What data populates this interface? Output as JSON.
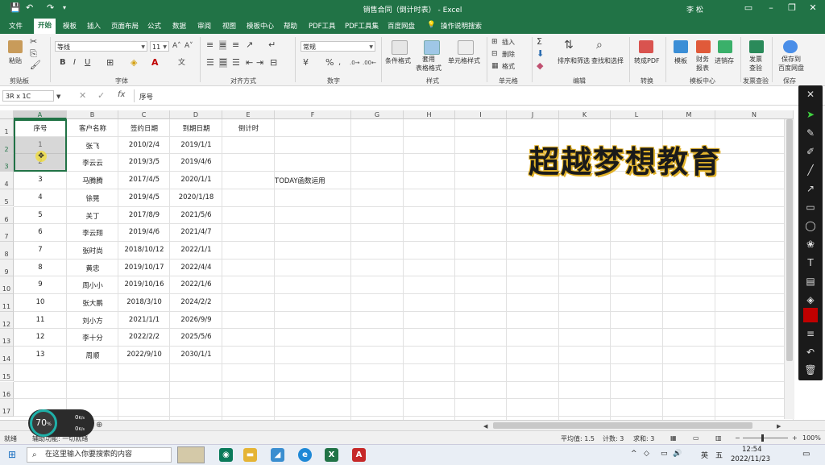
{
  "window": {
    "title": "销售合同（倒计时表） - Excel",
    "user": "李 松"
  },
  "menu": [
    "文件",
    "开始",
    "模板",
    "插入",
    "页面布局",
    "公式",
    "数据",
    "审阅",
    "视图",
    "模板中心",
    "帮助",
    "PDF工具",
    "PDF工具集",
    "百度网盘",
    "操作说明搜索"
  ],
  "active_tab": "开始",
  "ribbon": {
    "clipboard": {
      "paste": "粘贴",
      "label": "剪贴板"
    },
    "font": {
      "name": "等线",
      "size": "11",
      "label": "字体",
      "bold": "B",
      "italic": "I",
      "underline": "U"
    },
    "alignment": {
      "label": "对齐方式"
    },
    "number": {
      "format": "常规",
      "label": "数字"
    },
    "styles": {
      "cond": "条件格式",
      "table": "套用\n表格格式",
      "cell": "单元格样式",
      "label": "样式"
    },
    "cells": {
      "insert": "插入",
      "delete": "删除",
      "format": "格式",
      "label": "单元格"
    },
    "editing": {
      "sort": "排序和筛选",
      "find": "查找和选择",
      "label": "编辑"
    },
    "convert": {
      "pdf": "转成PDF",
      "label": "转换"
    },
    "template": {
      "tmpl": "模板",
      "fin": "财务\n报表",
      "sales": "进销存",
      "label": "模板中心"
    },
    "invoice": {
      "check": "发票\n查验",
      "label": "发票查验"
    },
    "save": {
      "baidu": "保存到\n百度网盘",
      "label": "保存"
    }
  },
  "formula_bar": {
    "name_box": "3R x 1C",
    "fx": "fx",
    "content": "序号"
  },
  "columns": [
    "A",
    "B",
    "C",
    "D",
    "E",
    "F",
    "G",
    "H",
    "I",
    "J",
    "K",
    "L",
    "M",
    "N"
  ],
  "rows": [
    "1",
    "2",
    "3",
    "4",
    "5",
    "6",
    "7",
    "8",
    "9",
    "10",
    "11",
    "12",
    "13",
    "14",
    "15",
    "16",
    "17"
  ],
  "table": {
    "headers": [
      "序号",
      "客户名称",
      "签约日期",
      "到期日期",
      "倒计时"
    ],
    "rows": [
      [
        "1",
        "张飞",
        "2010/2/4",
        "2019/1/1"
      ],
      [
        "2",
        "李云云",
        "2019/3/5",
        "2019/4/6"
      ],
      [
        "3",
        "马腾腾",
        "2017/4/5",
        "2020/1/1"
      ],
      [
        "4",
        "徐晃",
        "2019/4/5",
        "2020/1/18"
      ],
      [
        "5",
        "关丁",
        "2017/8/9",
        "2021/5/6"
      ],
      [
        "6",
        "李云翔",
        "2019/4/6",
        "2021/4/7"
      ],
      [
        "7",
        "张时尚",
        "2018/10/12",
        "2022/1/1"
      ],
      [
        "8",
        "黄忠",
        "2019/10/17",
        "2022/4/4"
      ],
      [
        "9",
        "周小小",
        "2019/10/16",
        "2022/1/6"
      ],
      [
        "10",
        "张大鹏",
        "2018/3/10",
        "2024/2/2"
      ],
      [
        "11",
        "刘小方",
        "2021/1/1",
        "2026/9/9"
      ],
      [
        "12",
        "李十分",
        "2022/2/2",
        "2025/5/6"
      ],
      [
        "13",
        "周顺",
        "2022/9/10",
        "2030/1/1"
      ]
    ],
    "note": "TODAY函数运用"
  },
  "watermark": "超越梦想教育",
  "status": {
    "ready": "就绪",
    "accessibility": "辅助功能: 一切就绪",
    "average": "平均值: 1.5",
    "count": "计数: 3",
    "sum": "求和: 3",
    "zoom": "100%"
  },
  "speed_widget": {
    "percent": "70",
    "unit": "%",
    "up": "0",
    "up_unit": "K/s",
    "down": "0",
    "down_unit": "K/s"
  },
  "taskbar": {
    "search_placeholder": "在这里输入你要搜索的内容",
    "time": "12:54",
    "date": "2022/11/23",
    "ime": "英",
    "ime2": "五"
  },
  "colors": {
    "excel_green": "#217346",
    "accent_red": "#c00000",
    "watermark_outline": "#e0b12a"
  }
}
